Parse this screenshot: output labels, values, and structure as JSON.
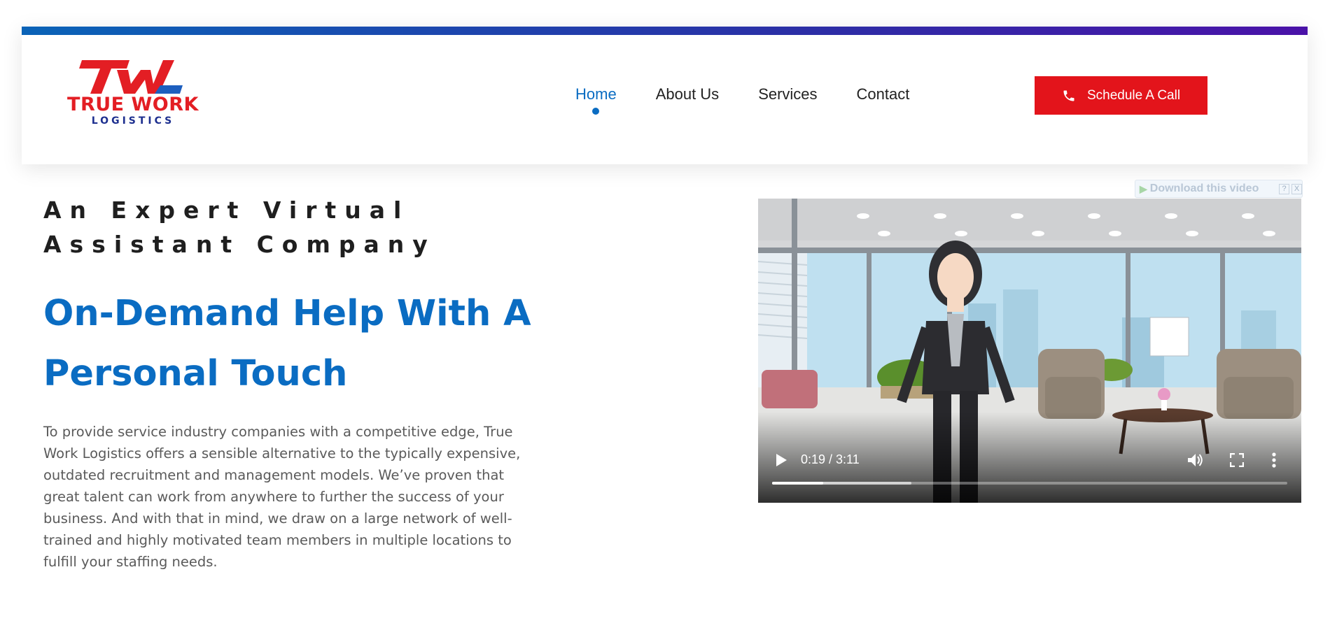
{
  "brand": {
    "logo_mark": "TW",
    "name": "TRUE WORK",
    "sub": "LOGISTICS",
    "colors": {
      "red": "#e31e24",
      "navy": "#1d2f8f"
    }
  },
  "nav": {
    "items": [
      {
        "label": "Home",
        "active": true
      },
      {
        "label": "About Us",
        "active": false
      },
      {
        "label": "Services",
        "active": false
      },
      {
        "label": "Contact",
        "active": false
      }
    ],
    "active_color": "#0a6cc2"
  },
  "cta": {
    "label": "Schedule A Call",
    "icon": "phone-icon",
    "color": "#e3141b"
  },
  "hero": {
    "tagline": "An Expert Virtual Assistant Company",
    "headline": "On-Demand Help With A Personal Touch",
    "description": "To provide service industry companies with a competitive edge, True Work Logistics offers a sensible alternative to the typically expensive, outdated recruitment and management models. We’ve proven that great talent can work from anywhere to further the success of your business. And with that in mind, we draw on a large network of well-trained and highly motivated team members in multiple locations to fulfill your staffing needs."
  },
  "download_badge": {
    "label": "Download this video",
    "help": "?",
    "close": "X"
  },
  "video": {
    "time_display": "0:19 / 3:11",
    "current_seconds": 19,
    "duration_seconds": 191,
    "buffered_fraction": 0.27,
    "controls": [
      "play-icon",
      "volume-icon",
      "fullscreen-icon",
      "more-options-icon"
    ]
  }
}
